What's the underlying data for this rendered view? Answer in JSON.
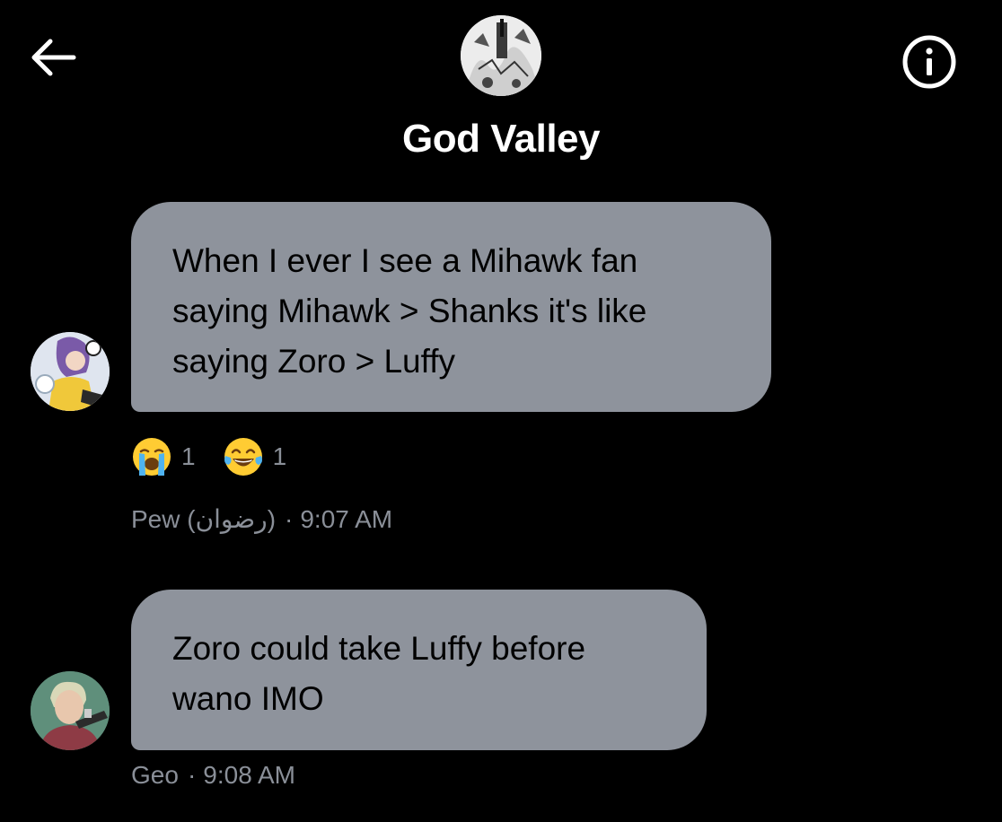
{
  "header": {
    "title": "God Valley",
    "back_icon": "arrow-left-icon",
    "info_icon": "info-icon"
  },
  "messages": [
    {
      "sender": "Pew (رضوان)",
      "time": "9:07 AM",
      "lines": [
        "When I ever I see a Mihawk fan",
        "saying Mihawk > Shanks it's like",
        "saying Zoro > Luffy"
      ],
      "reactions": [
        {
          "emoji": "loudly-crying-face-icon",
          "count": "1"
        },
        {
          "emoji": "face-with-tears-of-joy-icon",
          "count": "1"
        }
      ]
    },
    {
      "sender": "Geo",
      "time": "9:08 AM",
      "lines": [
        "Zoro could take Luffy before",
        "wano IMO"
      ]
    }
  ],
  "colors": {
    "background": "#000000",
    "bubble": "#8e939c",
    "meta_text": "#8a8f98",
    "title_text": "#ffffff"
  }
}
